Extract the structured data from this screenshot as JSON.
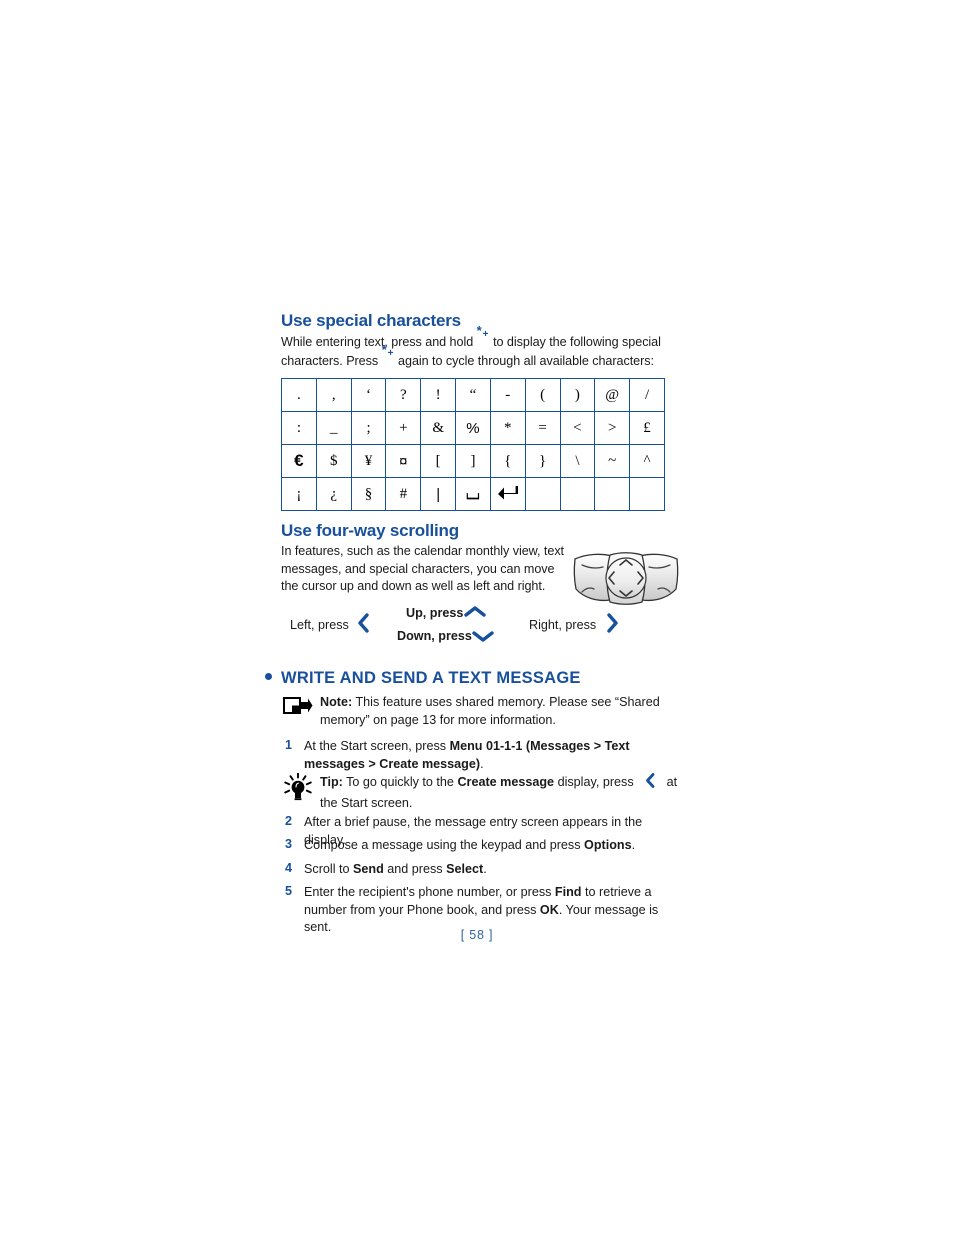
{
  "section_special_characters": {
    "heading": "Use special characters",
    "intro_part1": "While entering text, press and hold ",
    "intro_part2": " to display the following special characters. Press ",
    "intro_part3": " again to cycle through all available characters:",
    "star_key_glyph": "*",
    "star_key_modifier": "+",
    "table": {
      "rows": [
        [
          ".",
          ",",
          "‘",
          "?",
          "!",
          "“",
          "-",
          "(",
          ")",
          "@",
          "/"
        ],
        [
          ":",
          "_",
          ";",
          "+",
          "&",
          "%",
          "*",
          "=",
          "<",
          ">",
          "£"
        ],
        [
          "€",
          "$",
          "¥",
          "¤",
          "[",
          "]",
          "{",
          "}",
          "\\",
          "~",
          "^"
        ],
        [
          "¡",
          "¿",
          "§",
          "#",
          "|",
          "⌴",
          "↵",
          "",
          "",
          "",
          ""
        ]
      ]
    }
  },
  "section_four_way": {
    "heading": "Use four-way scrolling",
    "paragraph": "In features, such as the calendar monthly view, text messages, and special characters, you can move the cursor up and down as well as left and right.",
    "labels": {
      "left": "Left, press",
      "up": "Up, press",
      "down": "Down, press",
      "right": "Right, press"
    },
    "navkey_icon": "navigation-key-illustration"
  },
  "section_write_send": {
    "heading": "WRITE AND SEND A TEXT MESSAGE",
    "note": {
      "label": "Note:",
      "text": " This feature uses shared memory. Please see “Shared memory” on page 13 for more information.",
      "icon": "note-arrow-icon"
    },
    "tip": {
      "label": "Tip:",
      "text_part1": " To go quickly to the ",
      "bold_phrase": "Create message",
      "text_part2": " display, press ",
      "text_part3": " at the Start screen.",
      "icon": "lightbulb-icon"
    },
    "steps": [
      {
        "num": "1",
        "segments": [
          {
            "text": "At the Start screen, press ",
            "bold": false
          },
          {
            "text": "Menu 01-1-1 (Messages > Text messages > Create message)",
            "bold": true
          },
          {
            "text": ".",
            "bold": false
          }
        ]
      },
      {
        "num": "2",
        "segments": [
          {
            "text": "After a brief pause, the message entry screen appears in the display.",
            "bold": false
          }
        ]
      },
      {
        "num": "3",
        "segments": [
          {
            "text": "Compose a message using the keypad and press ",
            "bold": false
          },
          {
            "text": "Options",
            "bold": true
          },
          {
            "text": ".",
            "bold": false
          }
        ]
      },
      {
        "num": "4",
        "segments": [
          {
            "text": "Scroll to ",
            "bold": false
          },
          {
            "text": "Send",
            "bold": true
          },
          {
            "text": " and press ",
            "bold": false
          },
          {
            "text": "Select",
            "bold": true
          },
          {
            "text": ".",
            "bold": false
          }
        ]
      },
      {
        "num": "5",
        "segments": [
          {
            "text": "Enter the recipient's phone number, or press ",
            "bold": false
          },
          {
            "text": "Find",
            "bold": true
          },
          {
            "text": " to retrieve a number from your Phone book, and press ",
            "bold": false
          },
          {
            "text": "OK",
            "bold": true
          },
          {
            "text": ". Your message is sent.",
            "bold": false
          }
        ]
      }
    ]
  },
  "footer": {
    "page_number": "[ 58 ]"
  },
  "colors": {
    "heading_blue": "#18509b",
    "table_border_blue": "#17509c",
    "chevron_blue": "#17509c",
    "page_number_blue": "#2f62a8",
    "body_text": "#1a1a1a"
  }
}
